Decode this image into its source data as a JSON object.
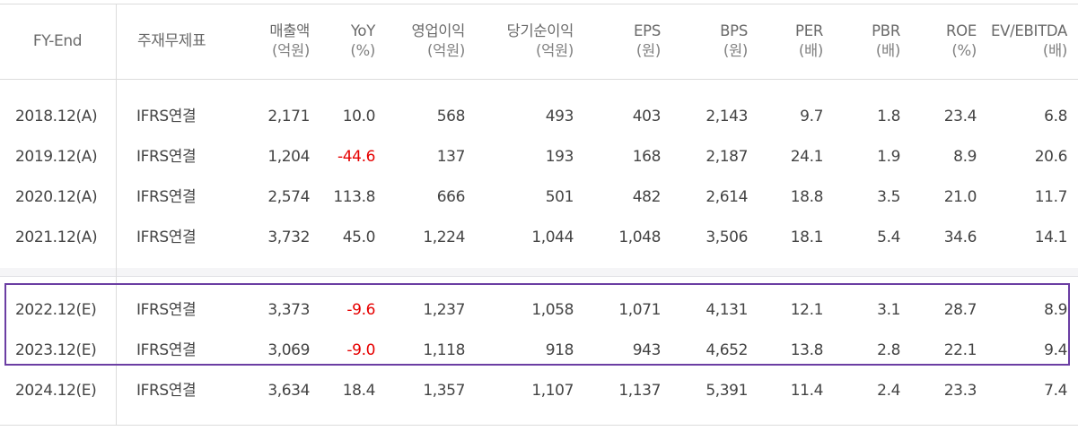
{
  "header": {
    "fy_end": "FY-End",
    "basis": "주재무제표",
    "columns": [
      {
        "label": "매출액",
        "unit": "(억원)"
      },
      {
        "label": "YoY",
        "unit": "(%)"
      },
      {
        "label": "영업이익",
        "unit": "(억원)"
      },
      {
        "label": "당기순이익",
        "unit": "(억원)"
      },
      {
        "label": "EPS",
        "unit": "(원)"
      },
      {
        "label": "BPS",
        "unit": "(원)"
      },
      {
        "label": "PER",
        "unit": "(배)"
      },
      {
        "label": "PBR",
        "unit": "(배)"
      },
      {
        "label": "ROE",
        "unit": "(%)"
      },
      {
        "label": "EV/EBITDA",
        "unit": "(배)"
      }
    ]
  },
  "rows": [
    {
      "year": "2018.12(A)",
      "basis": "IFRS연결",
      "values": [
        "2,171",
        "10.0",
        "568",
        "493",
        "403",
        "2,143",
        "9.7",
        "1.8",
        "23.4",
        "6.8"
      ]
    },
    {
      "year": "2019.12(A)",
      "basis": "IFRS연결",
      "values": [
        "1,204",
        "-44.6",
        "137",
        "193",
        "168",
        "2,187",
        "24.1",
        "1.9",
        "8.9",
        "20.6"
      ]
    },
    {
      "year": "2020.12(A)",
      "basis": "IFRS연결",
      "values": [
        "2,574",
        "113.8",
        "666",
        "501",
        "482",
        "2,614",
        "18.8",
        "3.5",
        "21.0",
        "11.7"
      ]
    },
    {
      "year": "2021.12(A)",
      "basis": "IFRS연결",
      "values": [
        "3,732",
        "45.0",
        "1,224",
        "1,044",
        "1,048",
        "3,506",
        "18.1",
        "5.4",
        "34.6",
        "14.1"
      ]
    },
    {
      "year": "2022.12(E)",
      "basis": "IFRS연결",
      "values": [
        "3,373",
        "-9.6",
        "1,237",
        "1,058",
        "1,071",
        "4,131",
        "12.1",
        "3.1",
        "28.7",
        "8.9"
      ]
    },
    {
      "year": "2023.12(E)",
      "basis": "IFRS연결",
      "values": [
        "3,069",
        "-9.0",
        "1,118",
        "918",
        "943",
        "4,652",
        "13.8",
        "2.8",
        "22.1",
        "9.4"
      ]
    },
    {
      "year": "2024.12(E)",
      "basis": "IFRS연결",
      "values": [
        "3,634",
        "18.4",
        "1,357",
        "1,107",
        "1,137",
        "5,391",
        "11.4",
        "2.4",
        "23.3",
        "7.4"
      ]
    }
  ],
  "colors": {
    "negative": "#e60000",
    "highlight_border": "#6b3ea3"
  }
}
